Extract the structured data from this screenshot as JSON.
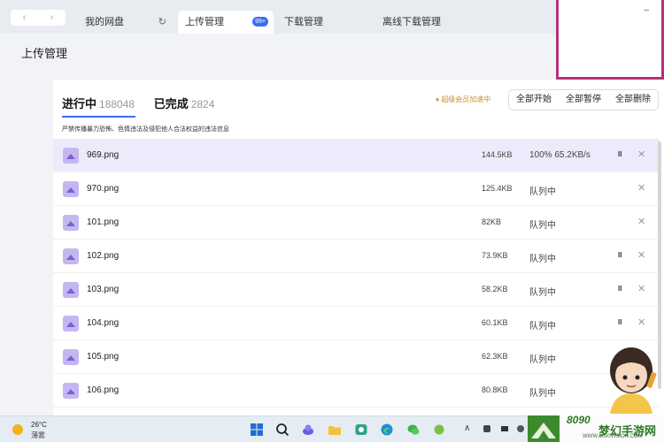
{
  "nav": {
    "back": "‹",
    "forward": "›"
  },
  "tabs": [
    {
      "label": "我的网盘",
      "icon": "↻"
    },
    {
      "label": "上传管理",
      "badge": "99+"
    },
    {
      "label": "下载管理"
    },
    {
      "label": "离线下载管理"
    }
  ],
  "window": {
    "minimize": "–"
  },
  "page_title": "上传管理",
  "stats": {
    "in_progress_label": "进行中",
    "in_progress_count": "188048",
    "done_label": "已完成",
    "done_count": "2824"
  },
  "warning": "严禁传播暴力恐怖、色情违法及侵犯他人合法权益的违法信息",
  "vip": "超级会员加速中",
  "bulk_actions": {
    "start_all": "全部开始",
    "pause_all": "全部暂停",
    "delete_all": "全部删除"
  },
  "files": [
    {
      "name": "969.png",
      "size": "144.5KB",
      "status": "100% 65.2KB/s"
    },
    {
      "name": "970.png",
      "size": "125.4KB",
      "status": "队列中"
    },
    {
      "name": "101.png",
      "size": "82KB",
      "status": "队列中"
    },
    {
      "name": "102.png",
      "size": "73.9KB",
      "status": "队列中"
    },
    {
      "name": "103.png",
      "size": "58.2KB",
      "status": "队列中"
    },
    {
      "name": "104.png",
      "size": "60.1KB",
      "status": "队列中"
    },
    {
      "name": "105.png",
      "size": "62.3KB",
      "status": "队列中"
    },
    {
      "name": "106.png",
      "size": "80.8KB",
      "status": "队列中"
    }
  ],
  "row_controls": {
    "pause": "II",
    "close": "✕"
  },
  "taskbar": {
    "weather_temp": "26°C",
    "weather_desc": "薄雾",
    "tray_chevron": "∧"
  },
  "watermark": {
    "number": "8090",
    "name": "梦幻手游网",
    "url": "WWW.8090VISION.COM"
  },
  "colors": {
    "accent": "#3b6cf5",
    "highlight_row": "#ecebfb",
    "window_border": "#b5307c",
    "file_icon": "#c4b7f0"
  }
}
